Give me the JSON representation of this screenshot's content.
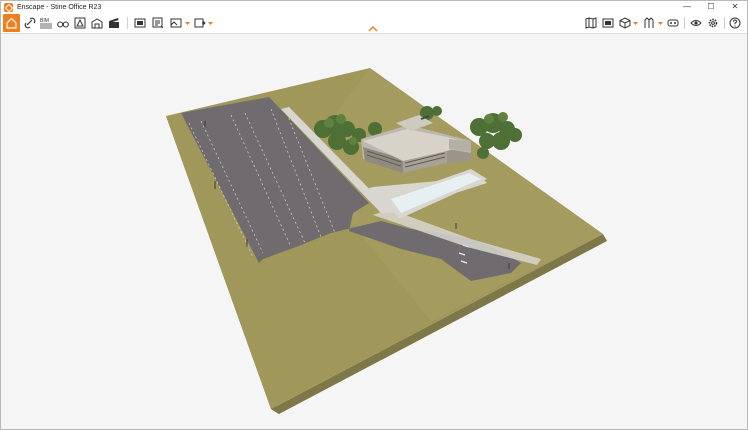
{
  "window": {
    "title": "Enscape - Stine Office R23",
    "app_icon": "enscape-logo-icon",
    "controls": {
      "minimize": "—",
      "maximize": "☐",
      "close": "✕"
    }
  },
  "toolbar": {
    "accent_color": "#f07e1f",
    "left_icons": [
      "home-icon",
      "link-icon",
      "bim-icon",
      "binoculars-icon",
      "atmosphere-icon",
      "building-icon",
      "clapperboard-icon",
      "screenshot-icon",
      "batch-render-icon",
      "export-image-icon",
      "export-panorama-icon"
    ],
    "right_icons": [
      "map-icon",
      "panorama-gallery-icon",
      "view-cube-icon",
      "asset-library-icon",
      "vr-headset-icon",
      "visibility-eye-icon",
      "settings-gear-icon",
      "help-icon"
    ],
    "bim_label": "BIM"
  },
  "viewport": {
    "scene": "site-aerial-view",
    "colors": {
      "background": "#f5f5f5",
      "grass": "#a0985a",
      "ground_side": "#8c8550",
      "asphalt": "#6f6b6e",
      "path": "#d8d6cf",
      "pool": "#e6f0f2",
      "building": "#cfcac0",
      "trees": "#4e6f35"
    }
  }
}
